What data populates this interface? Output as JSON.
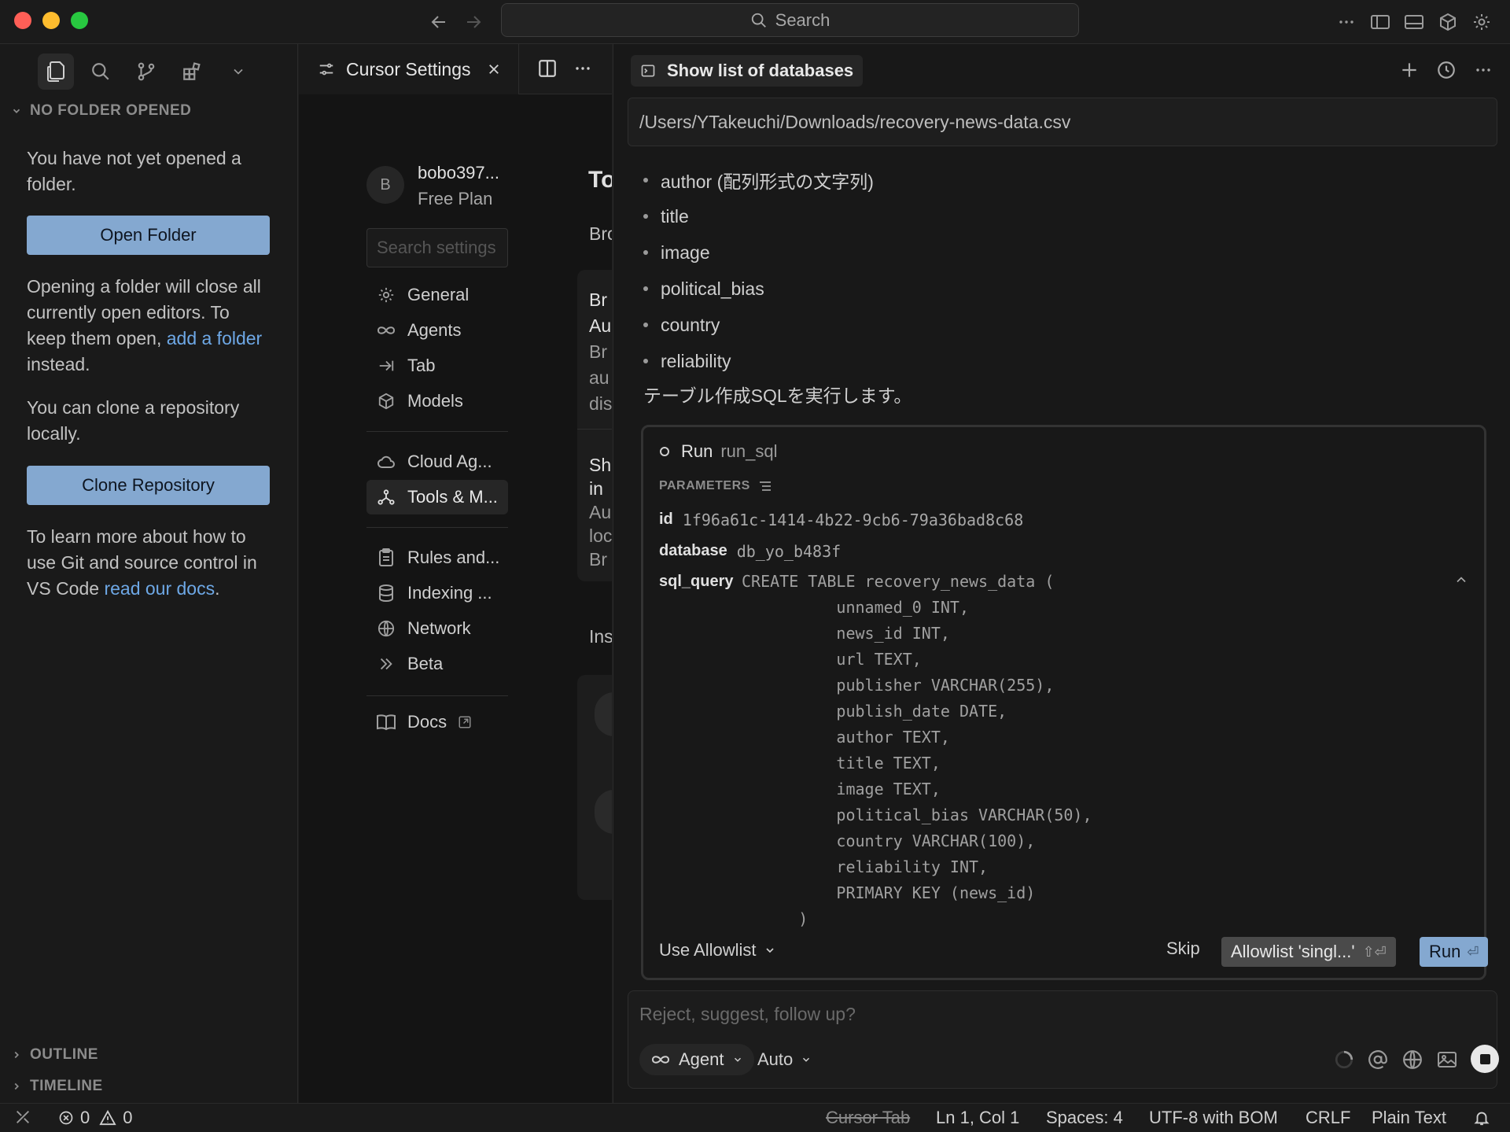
{
  "titlebar": {
    "search_label": "Search"
  },
  "sidebar": {
    "section_title": "NO FOLDER OPENED",
    "msg_not_opened": "You have not yet opened a folder.",
    "open_folder_button": "Open Folder",
    "msg_opening_1": "Opening a folder will close all currently open editors. To keep them open, ",
    "msg_opening_link": "add a folder",
    "msg_opening_2": " instead.",
    "msg_clone": "You can clone a repository locally.",
    "clone_button": "Clone Repository",
    "msg_learn_1": "To learn more about how to use Git and source control in VS Code ",
    "msg_learn_link": "read our docs",
    "msg_learn_2": ".",
    "outline_title": "OUTLINE",
    "timeline_title": "TIMELINE"
  },
  "settings": {
    "tab_title": "Cursor Settings",
    "user_initial": "B",
    "user_name": "bobo397...",
    "user_plan": "Free Plan",
    "search_placeholder": "Search settings",
    "nav": [
      {
        "label": "General",
        "icon": "gear-icon"
      },
      {
        "label": "Agents",
        "icon": "infinity-icon"
      },
      {
        "label": "Tab",
        "icon": "tab-arrow-icon"
      },
      {
        "label": "Models",
        "icon": "cube-icon"
      },
      {
        "label": "Cloud Ag...",
        "icon": "cloud-icon"
      },
      {
        "label": "Tools & M...",
        "icon": "tools-icon"
      },
      {
        "label": "Rules and...",
        "icon": "clipboard-icon"
      },
      {
        "label": "Indexing ...",
        "icon": "database-icon"
      },
      {
        "label": "Network",
        "icon": "globe-icon"
      },
      {
        "label": "Beta",
        "icon": "chevrons-right-icon"
      },
      {
        "label": "Docs",
        "icon": "book-icon"
      }
    ],
    "partial": {
      "heading": "To",
      "sub": "Bro",
      "card1": [
        "Br",
        "Au",
        "Br",
        "au",
        "dis"
      ],
      "card2": [
        "Sh",
        "in",
        "Au",
        "loc",
        "Br"
      ],
      "section2": "Ins"
    }
  },
  "chat": {
    "tab_title": "Show list of databases",
    "path": "/Users/YTakeuchi/Downloads/recovery-news-data.csv",
    "columns": [
      "author (配列形式の文字列)",
      "title",
      "image",
      "political_bias",
      "country",
      "reliability"
    ],
    "message": "テーブル作成SQLを実行します。",
    "tool": {
      "run_label": "Run",
      "tool_name": "run_sql",
      "params_label": "PARAMETERS",
      "id_key": "id",
      "id_value": "1f96a61c-1414-4b22-9cb6-79a36bad8c68",
      "database_key": "database",
      "database_value": "db_yo_b483f",
      "sql_key": "sql_query",
      "sql_value": "CREATE TABLE recovery_news_data (\n          unnamed_0 INT,\n          news_id INT,\n          url TEXT,\n          publisher VARCHAR(255),\n          publish_date DATE,\n          author TEXT,\n          title TEXT,\n          image TEXT,\n          political_bias VARCHAR(50),\n          country VARCHAR(100),\n          reliability INT,\n          PRIMARY KEY (news_id)\n      )",
      "use_allowlist": "Use Allowlist",
      "skip": "Skip",
      "allowlist_button": "Allowlist 'singl...'",
      "allowlist_shortcut": "⇧⏎",
      "run_button": "Run",
      "run_shortcut": "⏎"
    },
    "input_placeholder": "Reject, suggest, follow up?",
    "mode": "Agent",
    "model": "Auto"
  },
  "statusbar": {
    "errors": "0",
    "warnings": "0",
    "cursor_tab": "Cursor Tab",
    "position": "Ln 1, Col 1",
    "spaces": "Spaces: 4",
    "encoding": "UTF-8 with BOM",
    "eol": "CRLF",
    "language": "Plain Text"
  },
  "colors": {
    "accent": "#84a8d0",
    "link": "#6ea8e6",
    "close": "#ff5f57",
    "minimize": "#febc2e",
    "zoom": "#28c840"
  }
}
